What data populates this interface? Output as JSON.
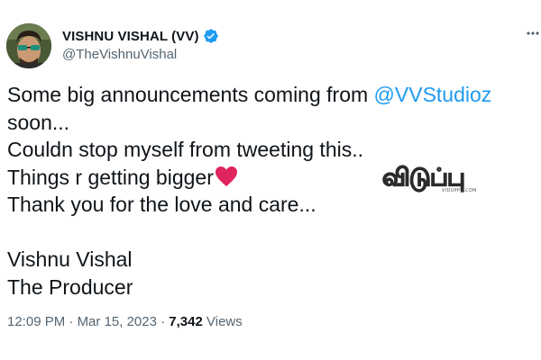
{
  "author": {
    "display_name": "VISHNU VISHAL (VV)",
    "handle": "@TheVishnuVishal",
    "verified": true,
    "avatar_icon": "avatar-photo"
  },
  "more_icon": "more-options-icon",
  "tweet": {
    "lines": [
      {
        "prefix": "Some big announcements coming from ",
        "mention": "@VVStudioz"
      },
      {
        "text": "soon..."
      },
      {
        "text": "Couldn stop myself from tweeting this.."
      },
      {
        "text": "Things r getting bigger",
        "emoji": "heart-icon"
      },
      {
        "text": "Thank you for the love and care..."
      },
      {
        "text": ""
      },
      {
        "text": "Vishnu Vishal"
      },
      {
        "text": "The Producer"
      }
    ]
  },
  "meta": {
    "time": "12:09 PM",
    "separator1": " · ",
    "date": "Mar 15, 2023",
    "separator2": " · ",
    "views_count": "7,342",
    "views_label": " Views"
  },
  "watermark": {
    "text": "விடுப்பு",
    "subtext": "VIDUPPU.COM"
  },
  "colors": {
    "text": "#0f1419",
    "secondary": "#536471",
    "link": "#1d9bf0",
    "verified": "#1d9bf0",
    "heart": "#e0245e"
  }
}
